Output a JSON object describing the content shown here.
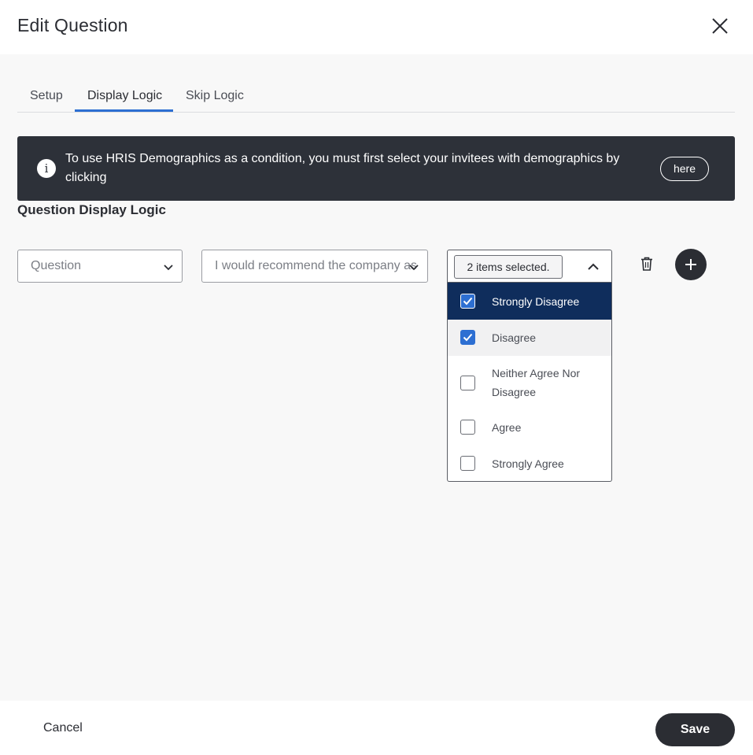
{
  "header": {
    "title": "Edit Question",
    "close_icon": "close-icon"
  },
  "tabs": [
    {
      "label": "Setup",
      "active": false
    },
    {
      "label": "Display Logic",
      "active": true
    },
    {
      "label": "Skip Logic",
      "active": false
    }
  ],
  "banner": {
    "icon": "info-icon",
    "icon_glyph": "i",
    "text": "To use HRIS Demographics as a condition, you must first select your invitees with demographics by clicking",
    "here_label": "here"
  },
  "section": {
    "title": "Question Display Logic"
  },
  "condition": {
    "type_select": {
      "value": "Question"
    },
    "question_select": {
      "value": "I would recommend the company as a great place to work."
    },
    "answers_select": {
      "summary": "2 items selected.",
      "options": [
        {
          "label": "Strongly Disagree",
          "checked": true,
          "highlighted": true
        },
        {
          "label": "Disagree",
          "checked": true,
          "hovered": true
        },
        {
          "label": "Neither Agree Nor Disagree",
          "checked": false
        },
        {
          "label": "Agree",
          "checked": false
        },
        {
          "label": "Strongly Agree",
          "checked": false
        }
      ]
    }
  },
  "footer": {
    "cancel_label": "Cancel",
    "save_label": "Save"
  },
  "colors": {
    "accent": "#2d6fd2",
    "dark": "#2b2d33",
    "banner_bg": "#2d3139",
    "highlight_bg": "#0f2d5c"
  }
}
